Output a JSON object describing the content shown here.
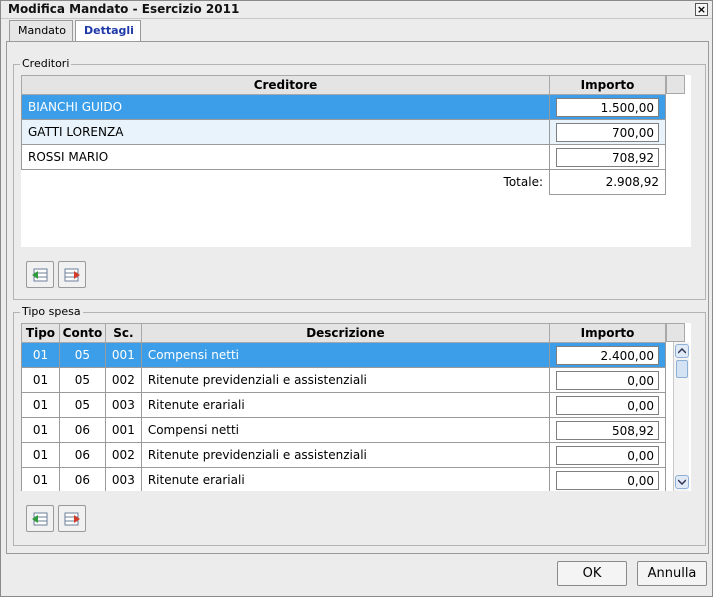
{
  "window": {
    "title": "Modifica Mandato - Esercizio 2011",
    "close_glyph": "×"
  },
  "tabs": [
    {
      "label": "Mandato",
      "active": false
    },
    {
      "label": "Dettagli",
      "active": true
    }
  ],
  "creditori": {
    "legend": "Creditori",
    "columns": [
      "Creditore",
      "Importo"
    ],
    "rows": [
      {
        "name": "BIANCHI GUIDO",
        "amount": "1.500,00",
        "selected": true
      },
      {
        "name": "GATTI LORENZA",
        "amount": "700,00",
        "selected": false
      },
      {
        "name": "ROSSI MARIO",
        "amount": "708,92",
        "selected": false
      }
    ],
    "total_label": "Totale:",
    "total_value": "2.908,92"
  },
  "tipo_spesa": {
    "legend": "Tipo spesa",
    "columns": [
      "Tipo",
      "Conto",
      "Sc.",
      "Descrizione",
      "Importo"
    ],
    "rows": [
      {
        "tipo": "01",
        "conto": "05",
        "sc": "001",
        "descr": "Compensi netti",
        "amount": "2.400,00",
        "selected": true
      },
      {
        "tipo": "01",
        "conto": "05",
        "sc": "002",
        "descr": "Ritenute previdenziali e assistenziali",
        "amount": "0,00",
        "selected": false
      },
      {
        "tipo": "01",
        "conto": "05",
        "sc": "003",
        "descr": "Ritenute erariali",
        "amount": "0,00",
        "selected": false
      },
      {
        "tipo": "01",
        "conto": "06",
        "sc": "001",
        "descr": "Compensi netti",
        "amount": "508,92",
        "selected": false
      },
      {
        "tipo": "01",
        "conto": "06",
        "sc": "002",
        "descr": "Ritenute previdenziali e assistenziali",
        "amount": "0,00",
        "selected": false
      },
      {
        "tipo": "01",
        "conto": "06",
        "sc": "003",
        "descr": "Ritenute erariali",
        "amount": "0,00",
        "selected": false
      }
    ]
  },
  "icons": {
    "add": "add-row-icon",
    "remove": "remove-row-icon"
  },
  "colors": {
    "selection": "#3c9ee8",
    "alt_row": "#e9f3fb",
    "active_tab_text": "#1f3aa8"
  },
  "footer": {
    "ok_label": "OK",
    "cancel_label": "Annulla"
  }
}
